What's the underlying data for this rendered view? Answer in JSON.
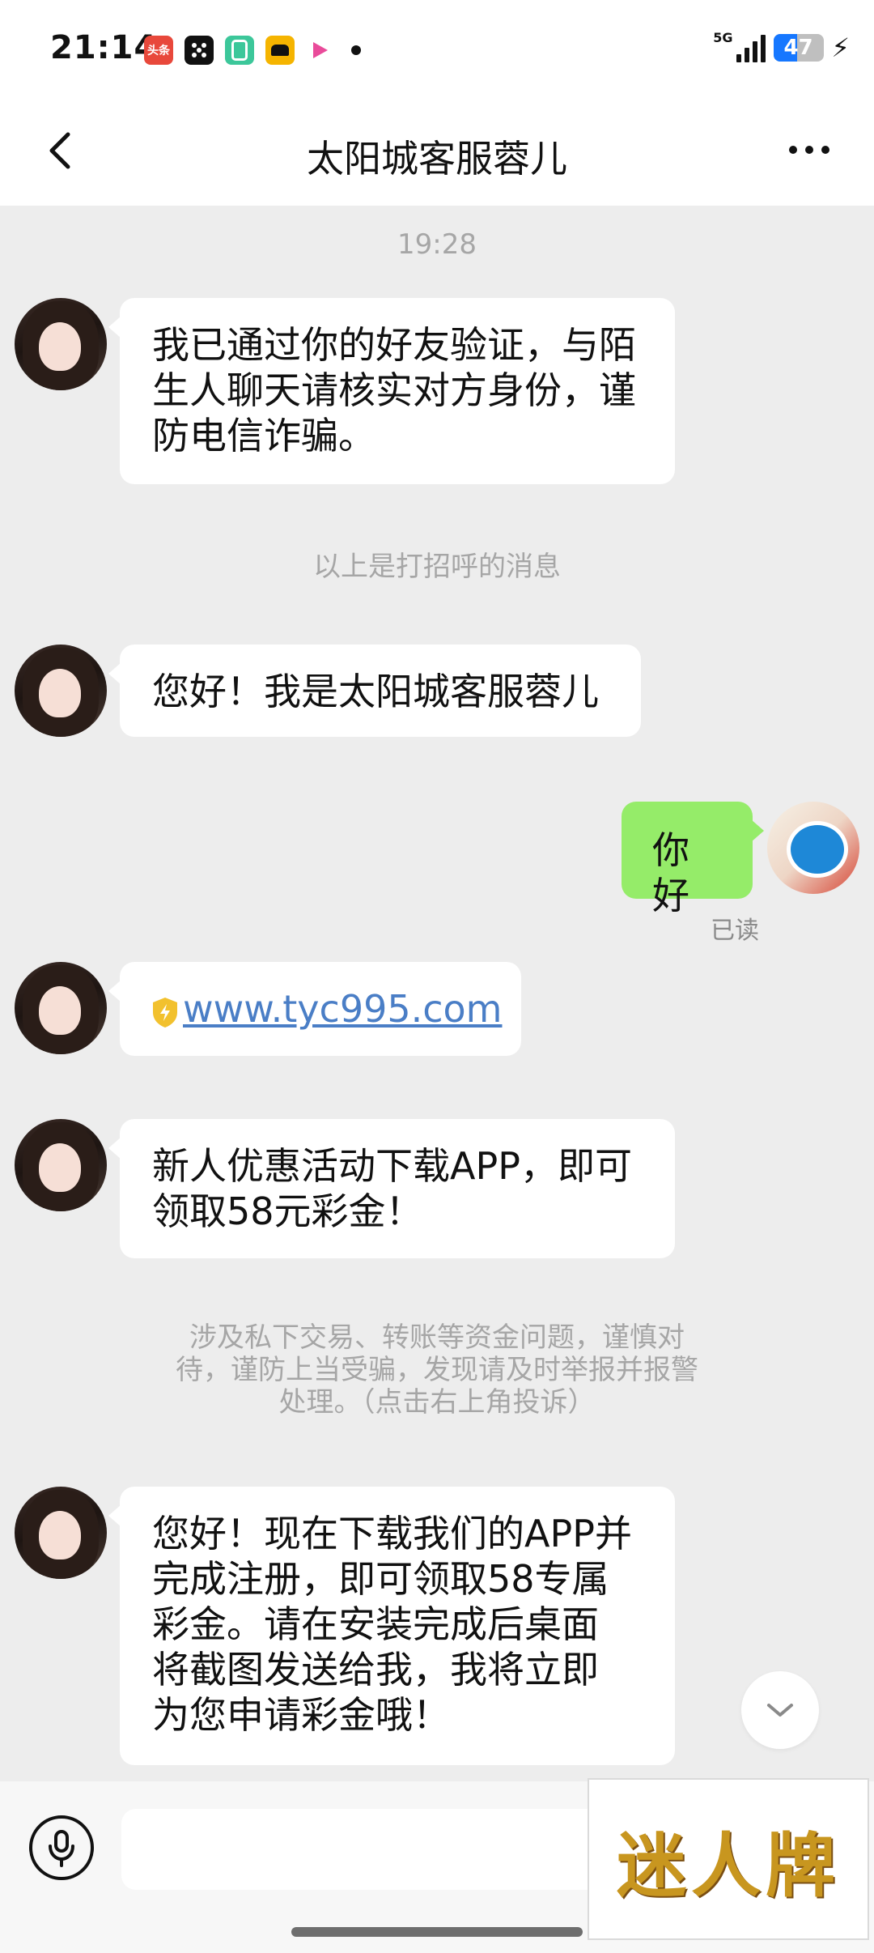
{
  "status_bar": {
    "time": "21:14",
    "notifications": [
      {
        "icon": "toutiao-app-icon",
        "label": "头条",
        "color": "#E8483B"
      },
      {
        "icon": "dice-app-icon",
        "label": "",
        "color": "#111111"
      },
      {
        "icon": "green-app-icon",
        "label": "",
        "color": "#3CC79A"
      },
      {
        "icon": "taxi-app-icon",
        "label": "",
        "color": "#F5B400"
      },
      {
        "icon": "video-app-icon",
        "label": "",
        "color": "#E94B9A"
      }
    ],
    "network": "5G",
    "battery": "47",
    "battery_level_percent": 47
  },
  "header": {
    "title": "太阳城客服蓉儿"
  },
  "chat": {
    "timestamp": "19:28",
    "messages": [
      {
        "from": "contact",
        "text": "我已通过你的好友验证，与陌生人聊天请核实对方身份，谨防电信诈骗。"
      },
      {
        "from": "contact",
        "text": "您好！我是太阳城客服蓉儿"
      },
      {
        "from": "me",
        "text": "你好",
        "status": "已读"
      },
      {
        "from": "contact",
        "link": "www.tyc995.com"
      },
      {
        "from": "contact",
        "text": "新人优惠活动下载APP，即可领取58元彩金！"
      },
      {
        "from": "contact",
        "text": "您好！现在下载我们的APP并完成注册，即可领取58专属彩金。请在安装完成后桌面将截图发送给我，我将立即为您申请彩金哦！"
      }
    ],
    "system_greeting_note": "以上是打招呼的消息",
    "warning_line1": "涉及私下交易、转账等资金问题，谨慎对",
    "warning_line2": "待，谨防上当受骗，发现请及时举报并报警",
    "warning_line3": "处理。（点击右上角投诉）"
  },
  "watermark": {
    "text": "迷人牌"
  },
  "colors": {
    "background": "#EDEDED",
    "my_bubble": "#95EC69",
    "their_bubble": "#FFFFFF",
    "link": "#4A7EC6"
  }
}
